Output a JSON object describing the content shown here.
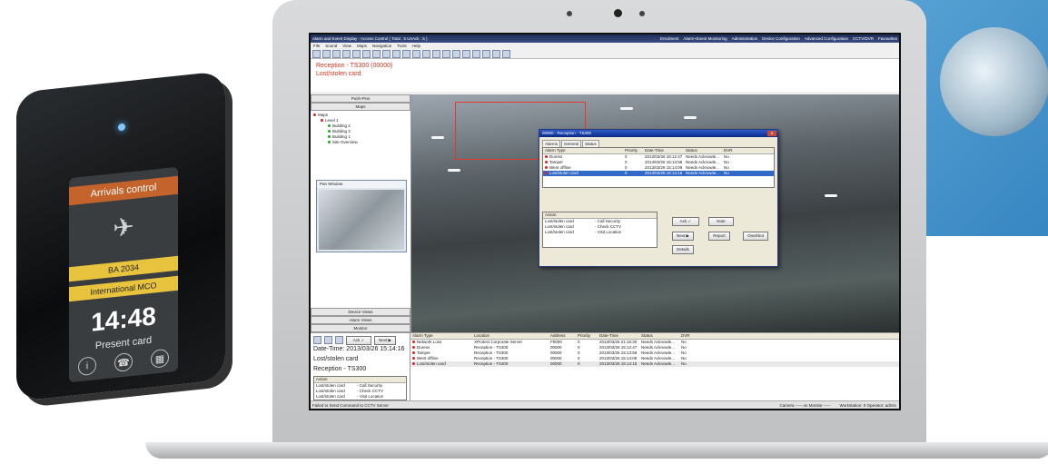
{
  "device": {
    "header": "Arrivals control",
    "flight": "BA 2034",
    "destination": "International MCO",
    "clock": "14:48",
    "prompt": "Present card"
  },
  "app": {
    "title": "Alarm and Event Display - Access Control  ( Total : 5   UnAck : 5 )",
    "nav": [
      "Enrolment",
      "Alarm+Event Monitoring",
      "Administration",
      "Device Configuration",
      "Advanced Configuration",
      "CCTV/DVR",
      "Favourites"
    ],
    "menu": [
      "File",
      "Sound",
      "View",
      "Maps",
      "Navigation",
      "Tools",
      "Help"
    ],
    "banner": {
      "line1": "Reception - TS300 (00000)",
      "line2": "Lost/stolen card"
    },
    "left_panel": {
      "push_pins": "Push-Pins",
      "maps": "Maps",
      "tree": [
        {
          "label": "Maps",
          "level": 0
        },
        {
          "label": "Level 1",
          "level": 1
        },
        {
          "label": "Building 2",
          "level": 2
        },
        {
          "label": "Building 3",
          "level": 2
        },
        {
          "label": "Building 1",
          "level": 2
        },
        {
          "label": "Site Overview",
          "level": 2
        }
      ],
      "pan_window": "Pan Window",
      "tabs": [
        "Device Views",
        "Alarm Views",
        "Monitor"
      ]
    },
    "dialog": {
      "title": "00000 - Reception - TS300",
      "tabs": [
        "Alarms",
        "General",
        "Status"
      ],
      "columns": [
        "Alarm Type",
        "Priority",
        "Date-Time",
        "Status",
        "DVR"
      ],
      "rows": [
        [
          "Duress",
          "0",
          "2013/03/26 15:12:47",
          "Needs Acknowle...",
          "No"
        ],
        [
          "Tamper",
          "0",
          "2013/03/26 15:13:58",
          "Needs Acknowle...",
          "No"
        ],
        [
          "Went offline",
          "0",
          "2013/03/26 15:14:09",
          "Needs Acknowle...",
          "No"
        ],
        [
          "Lost/stolen card",
          "0",
          "2013/03/26 15:14:16",
          "Needs Acknowle...",
          "No"
        ]
      ],
      "action_header": "Action",
      "actions": [
        [
          "Lost/stolen card",
          "- Call Security"
        ],
        [
          "Lost/stolen card",
          "- Check CCTV"
        ],
        [
          "Lost/stolen card",
          "- Visit Location"
        ]
      ],
      "buttons": {
        "ack": "Ack ✓",
        "note": "Note",
        "next": "Next ▶",
        "report": "Report",
        "oneshot": "OneShot",
        "details": "Details"
      }
    },
    "bottom_left": {
      "ack": "Ack ✓",
      "next": "Next ▶",
      "datetime": "Date-Time: 2013/03/26 15:14:16",
      "alarm": "Lost/stolen card",
      "location": "Reception - TS300",
      "action_header": "Action",
      "actions": [
        [
          "Lost/stolen card",
          "- Call Security"
        ],
        [
          "Lost/stolen card",
          "- Check CCTV"
        ],
        [
          "Lost/stolen card",
          "- Visit Location"
        ]
      ]
    },
    "alarm_list": {
      "columns": [
        "Alarm Type",
        "Location",
        "Address",
        "Priority",
        "Date-Time",
        "Status",
        "DVR"
      ],
      "rows": [
        [
          "Network Loss",
          "XProtect Corporate Server",
          "F0000",
          "0",
          "2013/03/26 21:16:30",
          "Needs Acknowle...",
          "No"
        ],
        [
          "Duress",
          "Reception - TS300",
          "00000",
          "0",
          "2013/03/26 15:12:47",
          "Needs Acknowle...",
          "No"
        ],
        [
          "Tamper",
          "Reception - TS300",
          "00000",
          "0",
          "2013/03/26 15:13:58",
          "Needs Acknowle...",
          "No"
        ],
        [
          "Went offline",
          "Reception - TS300",
          "00000",
          "0",
          "2013/03/26 15:14:09",
          "Needs Acknowle...",
          "No"
        ],
        [
          "Lost/stolen card",
          "Reception - TS300",
          "00000",
          "0",
          "2013/03/26 15:14:16",
          "Needs Acknowle...",
          "No"
        ]
      ]
    },
    "status_bar": {
      "message": "Failed to Send Command to CCTV Server",
      "camera": "Camera -----  on  Monitor -----",
      "workstation": "Workstation: 0 Operator: admin"
    }
  }
}
